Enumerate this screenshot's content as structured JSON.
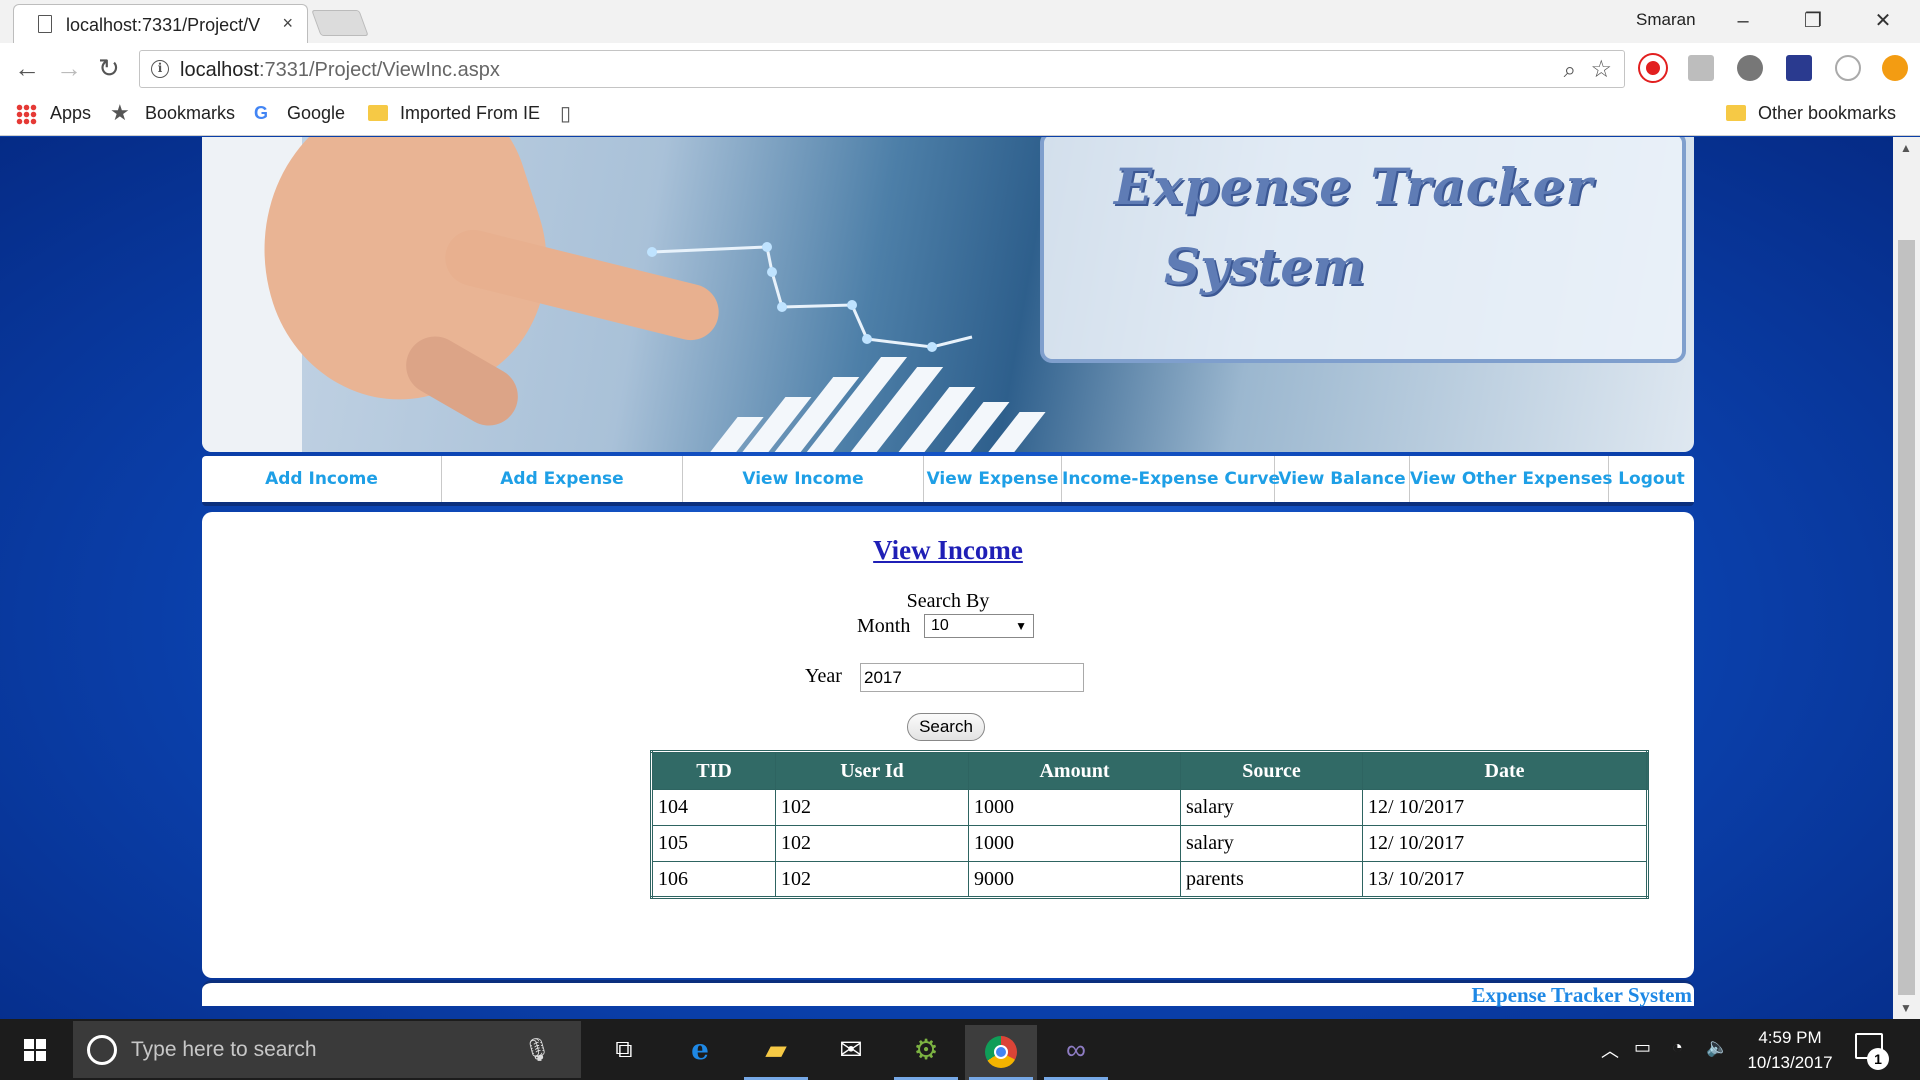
{
  "browser": {
    "tab_title": "localhost:7331/Project/V",
    "tab_close": "×",
    "profile_name": "Smaran",
    "window": {
      "minimize": "–",
      "restore": "❐",
      "close": "✕"
    },
    "url_host": "localhost",
    "url_rest": ":7331/Project/ViewInc.aspx",
    "bookmarks": {
      "apps": "Apps",
      "bookmarks": "Bookmarks",
      "google": "Google",
      "imported": "Imported From IE",
      "other": "Other bookmarks"
    }
  },
  "site": {
    "banner_title_line1": "Expense   Tracker",
    "banner_title_line2": "System",
    "menu": [
      "Add Income",
      "Add Expense",
      "View Income",
      "View Expense",
      "Income-Expense Curve",
      "View Balance",
      "View Other Expenses",
      "Logout"
    ],
    "footer": "Expense Tracker System"
  },
  "view_income": {
    "heading": "View Income",
    "search_by_label": "Search By",
    "month_label": "Month",
    "month_value": "10",
    "year_label": "Year",
    "year_value": "2017",
    "search_button": "Search",
    "table": {
      "headers": [
        "TID",
        "User Id",
        "Amount",
        "Source",
        "Date"
      ],
      "rows": [
        [
          "104",
          "102",
          "1000",
          "salary",
          "12/ 10/2017"
        ],
        [
          "105",
          "102",
          "1000",
          "salary",
          "12/ 10/2017"
        ],
        [
          "106",
          "102",
          "9000",
          "parents",
          "13/ 10/2017"
        ]
      ]
    }
  },
  "taskbar": {
    "search_placeholder": "Type here to search",
    "time": "4:59 PM",
    "date": "10/13/2017",
    "notification_count": "1"
  },
  "colors": {
    "menu_text": "#1e9fe6",
    "heading_link": "#1f1fb6",
    "table_header_bg": "#316a66",
    "page_bg": "#0c45b4"
  }
}
